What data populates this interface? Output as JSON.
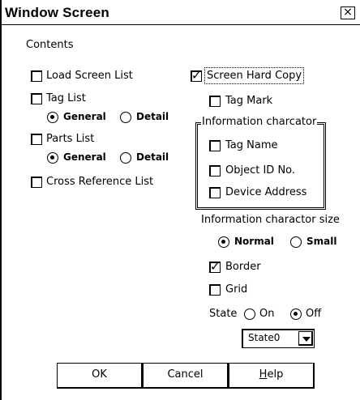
{
  "window": {
    "title": "Window Screen",
    "close_glyph": "×"
  },
  "contents_label": "Contents",
  "left": {
    "load_screen_list": {
      "label": "Load Screen List",
      "checked": false
    },
    "tag_list": {
      "label": "Tag List",
      "checked": false
    },
    "tag_list_options": {
      "general": "General",
      "detail": "Detail",
      "selected": "general"
    },
    "parts_list": {
      "label": "Parts List",
      "checked": false
    },
    "parts_list_options": {
      "general": "General",
      "detail": "Detail",
      "selected": "general"
    },
    "cross_reference_list": {
      "label": "Cross Reference List",
      "checked": false
    }
  },
  "right": {
    "screen_hard_copy": {
      "label": "Screen Hard Copy",
      "checked": true,
      "check_glyph": "✓"
    },
    "tag_mark": {
      "label": "Tag Mark",
      "checked": false
    },
    "info_group": {
      "title": "Information charcator",
      "tag_name": "Tag Name",
      "object_id": "Object ID No.",
      "device_address": "Device Address"
    },
    "info_size_label": "Information charactor size",
    "size_options": {
      "normal": "Normal",
      "small": "Small",
      "selected": "normal"
    },
    "border": {
      "label": "Border",
      "checked": true,
      "check_glyph": "✓"
    },
    "grid": {
      "label": "Grid",
      "checked": false
    },
    "state": {
      "label": "State",
      "on": "On",
      "off": "Off",
      "selected": "off"
    },
    "state_select": {
      "value": "State0"
    }
  },
  "buttons": {
    "ok": "OK",
    "cancel": "Cancel",
    "help": "Help"
  }
}
